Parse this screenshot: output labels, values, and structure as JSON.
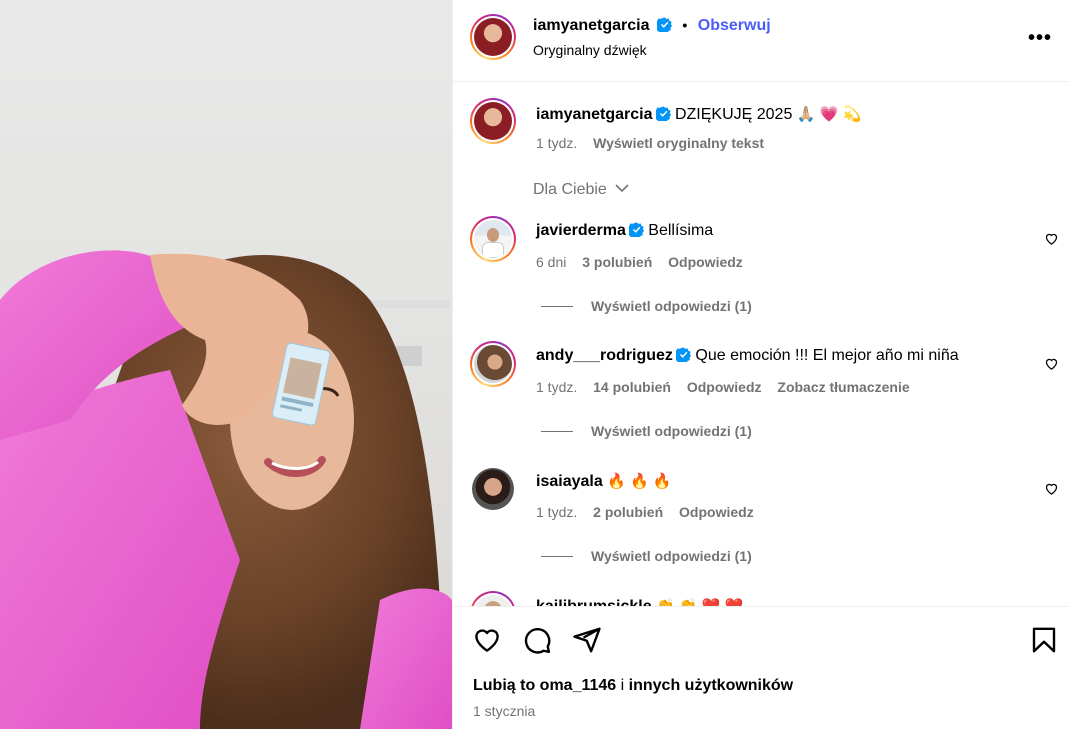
{
  "post": {
    "author": "iamyanetgarcia",
    "follow_label": "Obserwuj",
    "audio": "Oryginalny dźwięk",
    "more_icon": "more-options-icon"
  },
  "caption": {
    "username": "iamyanetgarcia",
    "text": "DZIĘKUJĘ 2025",
    "emojis": "🙏🏼 💗 💫",
    "time": "1 tydz.",
    "translate_label": "Wyświetl oryginalny tekst"
  },
  "filter": {
    "label": "Dla Ciebie"
  },
  "comments": [
    {
      "username": "javierderma",
      "text": "Bellísima",
      "time": "6 dni",
      "likes": "3 polubień",
      "reply": "Odpowiedz",
      "view_replies": "Wyświetl odpowiedzi (1)"
    },
    {
      "username": "andy___rodriguez",
      "text": "Que emoción !!! El mejor año mi niña",
      "time": "1 tydz.",
      "likes": "14 polubień",
      "reply": "Odpowiedz",
      "translate": "Zobacz tłumaczenie",
      "view_replies": "Wyświetl odpowiedzi (1)"
    },
    {
      "username": "isaiayala",
      "text": "🔥 🔥 🔥",
      "time": "1 tydz.",
      "likes": "2 polubień",
      "reply": "Odpowiedz",
      "view_replies": "Wyświetl odpowiedzi (1)"
    },
    {
      "username": "kailibrumsickle",
      "text": "👏 👏 ❤️ ❤️"
    }
  ],
  "footer": {
    "likes_prefix": "Lubią to",
    "likes_user": "oma_1146",
    "likes_mid": "i",
    "likes_suffix": "innych użytkowników",
    "date": "1 stycznia"
  },
  "colors": {
    "accent": "#4a5df9",
    "secondary_text": "#737373",
    "verified": "#0095f6",
    "divider": "#efefef"
  }
}
